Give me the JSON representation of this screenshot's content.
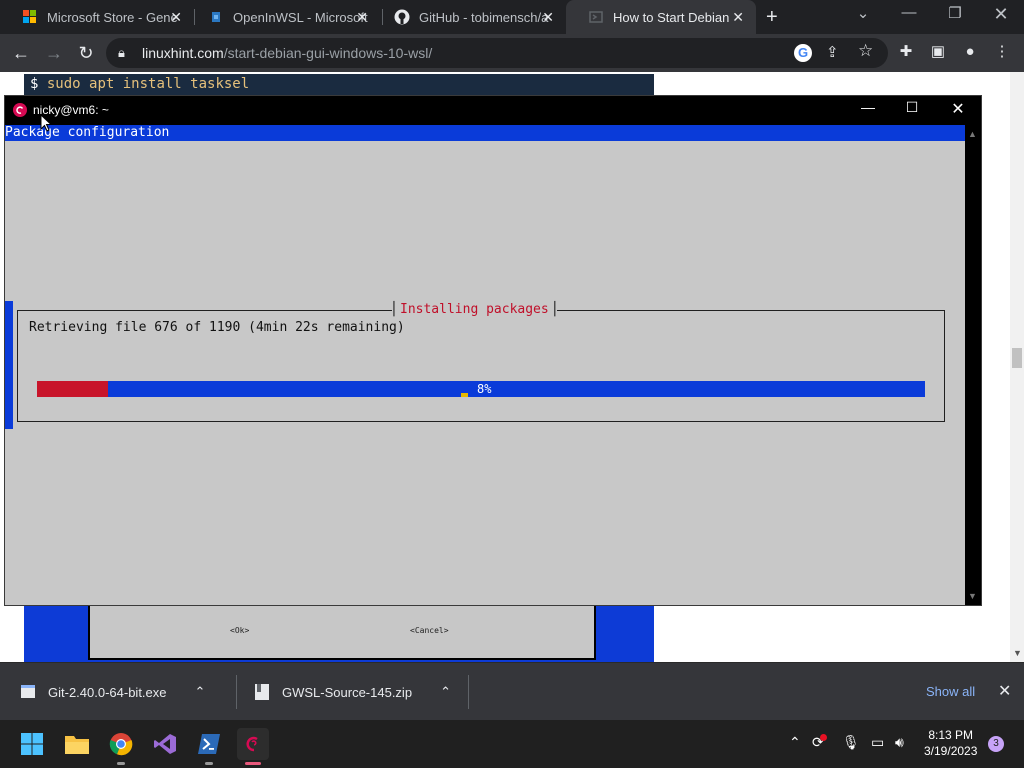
{
  "browser": {
    "tabs": [
      {
        "title": "Microsoft Store - Gene",
        "icon": "microsoft-store-icon"
      },
      {
        "title": "OpenInWSL - Microsoft",
        "icon": "visual-studio-icon"
      },
      {
        "title": "GitHub - tobimensch/a",
        "icon": "github-icon"
      },
      {
        "title": "How to Start Debian G",
        "icon": "linuxhint-icon",
        "active": true
      }
    ],
    "url_host": "linuxhint.com",
    "url_path": "/start-debian-gui-windows-10-wsl/"
  },
  "page": {
    "command_prompt": "$",
    "command": "sudo apt install tasksel",
    "ok_label": "<Ok>",
    "cancel_label": "<Cancel>"
  },
  "terminal": {
    "title": "nicky@vm6: ~",
    "header": "Package configuration",
    "dialog_title": "Installing packages",
    "status": "Retrieving file 676 of 1190 (4min 22s remaining)",
    "progress_percent": 8,
    "progress_label": "8%"
  },
  "downloads": {
    "items": [
      {
        "name": "Git-2.40.0-64-bit.exe"
      },
      {
        "name": "GWSL-Source-145.zip"
      }
    ],
    "show_all": "Show all"
  },
  "taskbar": {
    "time": "8:13 PM",
    "date": "3/19/2023",
    "notifications": "3"
  },
  "colors": {
    "dialog_blue": "#0a3bd9",
    "progress_red": "#c8142a",
    "dialog_title_red": "#c0102a",
    "debian_red": "#d70a53"
  }
}
